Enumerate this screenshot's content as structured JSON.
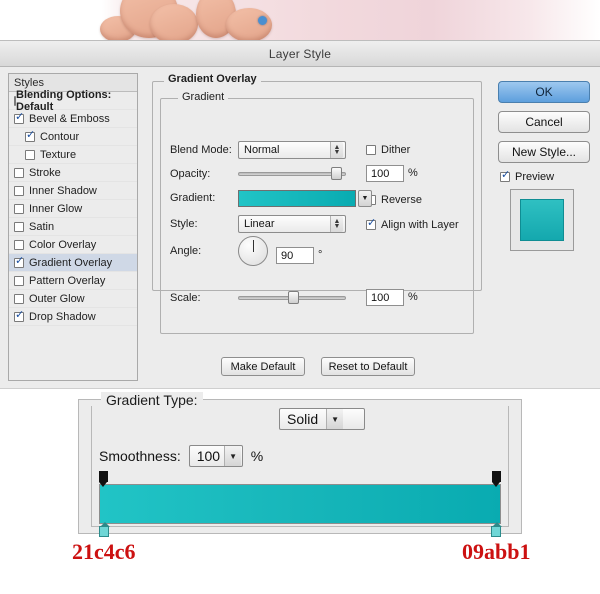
{
  "window": {
    "title": "Layer Style"
  },
  "styles_panel": {
    "header": "Styles",
    "items": [
      {
        "label": "Blending Options: Default",
        "checkbox": "none",
        "bold": true,
        "indent": 0,
        "selected": false
      },
      {
        "label": "Bevel & Emboss",
        "checkbox": "checked",
        "bold": false,
        "indent": 0,
        "selected": false
      },
      {
        "label": "Contour",
        "checkbox": "checked",
        "bold": false,
        "indent": 1,
        "selected": false
      },
      {
        "label": "Texture",
        "checkbox": "unchecked",
        "bold": false,
        "indent": 1,
        "selected": false
      },
      {
        "label": "Stroke",
        "checkbox": "unchecked",
        "bold": false,
        "indent": 0,
        "selected": false
      },
      {
        "label": "Inner Shadow",
        "checkbox": "unchecked",
        "bold": false,
        "indent": 0,
        "selected": false
      },
      {
        "label": "Inner Glow",
        "checkbox": "unchecked",
        "bold": false,
        "indent": 0,
        "selected": false
      },
      {
        "label": "Satin",
        "checkbox": "unchecked",
        "bold": false,
        "indent": 0,
        "selected": false
      },
      {
        "label": "Color Overlay",
        "checkbox": "unchecked",
        "bold": false,
        "indent": 0,
        "selected": false
      },
      {
        "label": "Gradient Overlay",
        "checkbox": "checked",
        "bold": false,
        "indent": 0,
        "selected": true
      },
      {
        "label": "Pattern Overlay",
        "checkbox": "unchecked",
        "bold": false,
        "indent": 0,
        "selected": false
      },
      {
        "label": "Outer Glow",
        "checkbox": "unchecked",
        "bold": false,
        "indent": 0,
        "selected": false
      },
      {
        "label": "Drop Shadow",
        "checkbox": "checked",
        "bold": false,
        "indent": 0,
        "selected": false
      }
    ]
  },
  "gradient_overlay": {
    "section_title": "Gradient Overlay",
    "sub_title": "Gradient",
    "blend_mode": {
      "label": "Blend Mode:",
      "value": "Normal"
    },
    "dither": {
      "label": "Dither",
      "checked": false
    },
    "opacity": {
      "label": "Opacity:",
      "value": "100",
      "unit": "%"
    },
    "reverse": {
      "label": "Reverse",
      "checked": false
    },
    "gradient": {
      "label": "Gradient:",
      "colors": [
        "#21c4c6",
        "#09abb1"
      ]
    },
    "style": {
      "label": "Style:",
      "value": "Linear"
    },
    "align_with_layer": {
      "label": "Align with Layer",
      "checked": true
    },
    "angle": {
      "label": "Angle:",
      "value": "90",
      "unit": "°"
    },
    "scale": {
      "label": "Scale:",
      "value": "100",
      "unit": "%"
    },
    "make_default": "Make Default",
    "reset_to_default": "Reset to Default"
  },
  "buttons": {
    "ok": "OK",
    "cancel": "Cancel",
    "new_style": "New Style...",
    "preview": {
      "label": "Preview",
      "checked": true
    }
  },
  "gradient_editor": {
    "legend": "Gradient Type:",
    "type_value": "Solid",
    "smoothness": {
      "label": "Smoothness:",
      "value": "100",
      "unit": "%"
    },
    "bar_colors": [
      "#21c4c6",
      "#09abb1"
    ]
  },
  "annotations": {
    "left_hex": "21c4c6",
    "right_hex": "09abb1",
    "hex_color": "#cc1111"
  }
}
